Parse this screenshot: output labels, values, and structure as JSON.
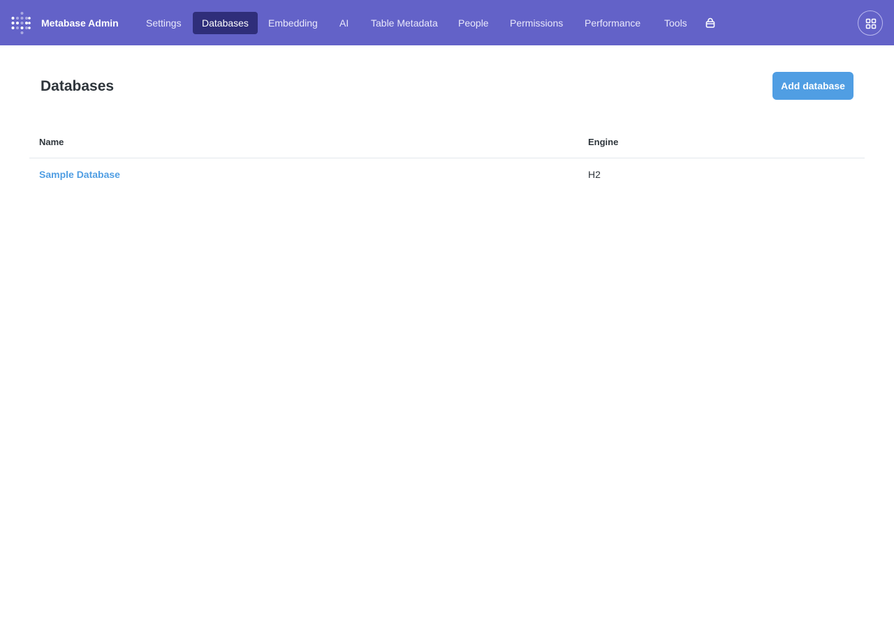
{
  "app": {
    "title": "Metabase Admin",
    "accent_color": "#6362c8",
    "active_nav_color": "#2f2e7a",
    "link_color": "#509ee3"
  },
  "nav": {
    "items": [
      {
        "label": "Settings",
        "active": false
      },
      {
        "label": "Databases",
        "active": true
      },
      {
        "label": "Embedding",
        "active": false
      },
      {
        "label": "AI",
        "active": false
      },
      {
        "label": "Table Metadata",
        "active": false
      },
      {
        "label": "People",
        "active": false
      },
      {
        "label": "Permissions",
        "active": false
      },
      {
        "label": "Performance",
        "active": false
      },
      {
        "label": "Tools",
        "active": false
      }
    ],
    "store_icon": "shopping-bag-icon",
    "apps_icon": "grid-icon"
  },
  "main": {
    "page_title": "Databases",
    "add_button_label": "Add database",
    "table": {
      "headers": [
        "Name",
        "Engine"
      ],
      "rows": [
        {
          "name": "Sample Database",
          "engine": "H2"
        }
      ]
    }
  }
}
